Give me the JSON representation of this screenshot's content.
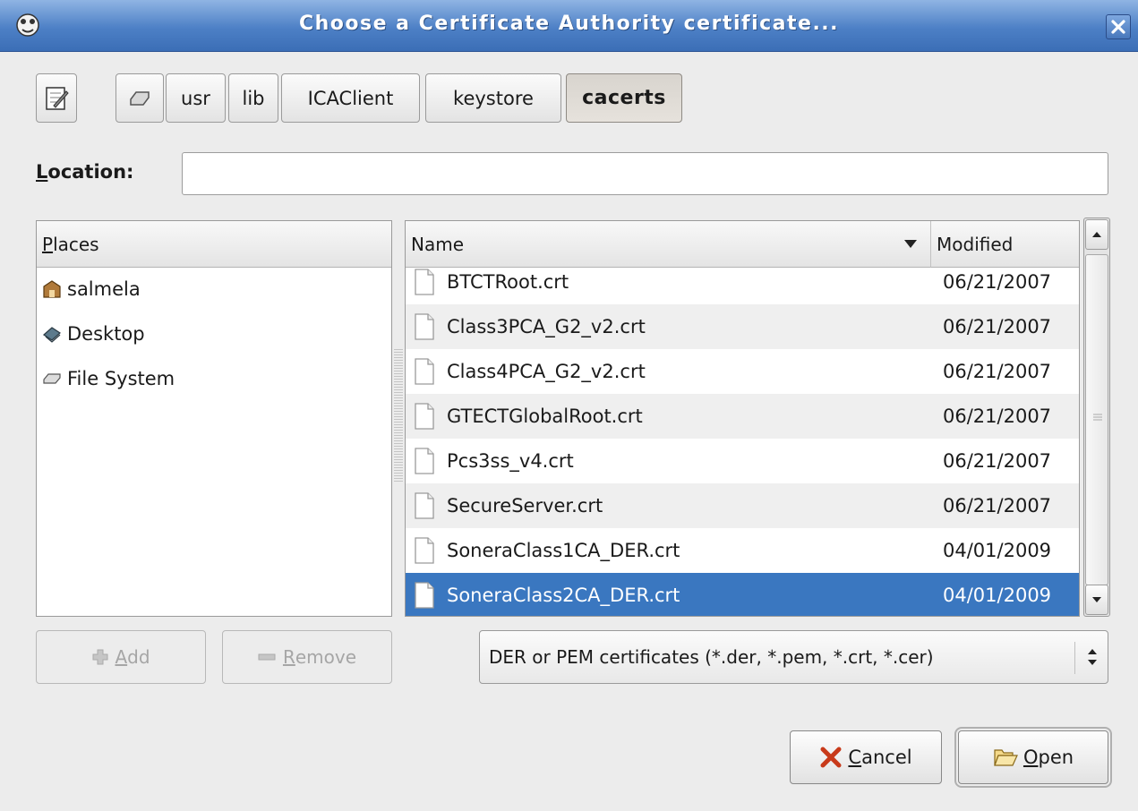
{
  "window": {
    "title": "Choose a Certificate Authority certificate..."
  },
  "path_bar": {
    "segments": [
      "usr",
      "lib",
      "ICAClient",
      "keystore",
      "cacerts"
    ]
  },
  "location": {
    "label_accel": "L",
    "label_rest": "ocation:",
    "value": ""
  },
  "places": {
    "header_accel": "P",
    "header_rest": "laces",
    "items": [
      "salmela",
      "Desktop",
      "File System"
    ]
  },
  "files": {
    "columns": {
      "name": "Name",
      "modified": "Modified"
    },
    "rows": [
      {
        "name": "BTCTRoot.crt",
        "modified": "06/21/2007"
      },
      {
        "name": "Class3PCA_G2_v2.crt",
        "modified": "06/21/2007"
      },
      {
        "name": "Class4PCA_G2_v2.crt",
        "modified": "06/21/2007"
      },
      {
        "name": "GTECTGlobalRoot.crt",
        "modified": "06/21/2007"
      },
      {
        "name": "Pcs3ss_v4.crt",
        "modified": "06/21/2007"
      },
      {
        "name": "SecureServer.crt",
        "modified": "06/21/2007"
      },
      {
        "name": "SoneraClass1CA_DER.crt",
        "modified": "04/01/2009"
      },
      {
        "name": "SoneraClass2CA_DER.crt",
        "modified": "04/01/2009"
      }
    ],
    "selected_index": 7
  },
  "buttons": {
    "add_accel": "A",
    "add_rest": "dd",
    "remove_accel": "R",
    "remove_rest": "emove",
    "cancel_accel": "C",
    "cancel_rest": "ancel",
    "open_accel": "O",
    "open_rest": "pen"
  },
  "filter": {
    "selected": "DER or PEM certificates (*.der, *.pem, *.crt, *.cer)"
  },
  "colors": {
    "selection": "#3a77c0",
    "titlebar": "#4d80c6"
  }
}
